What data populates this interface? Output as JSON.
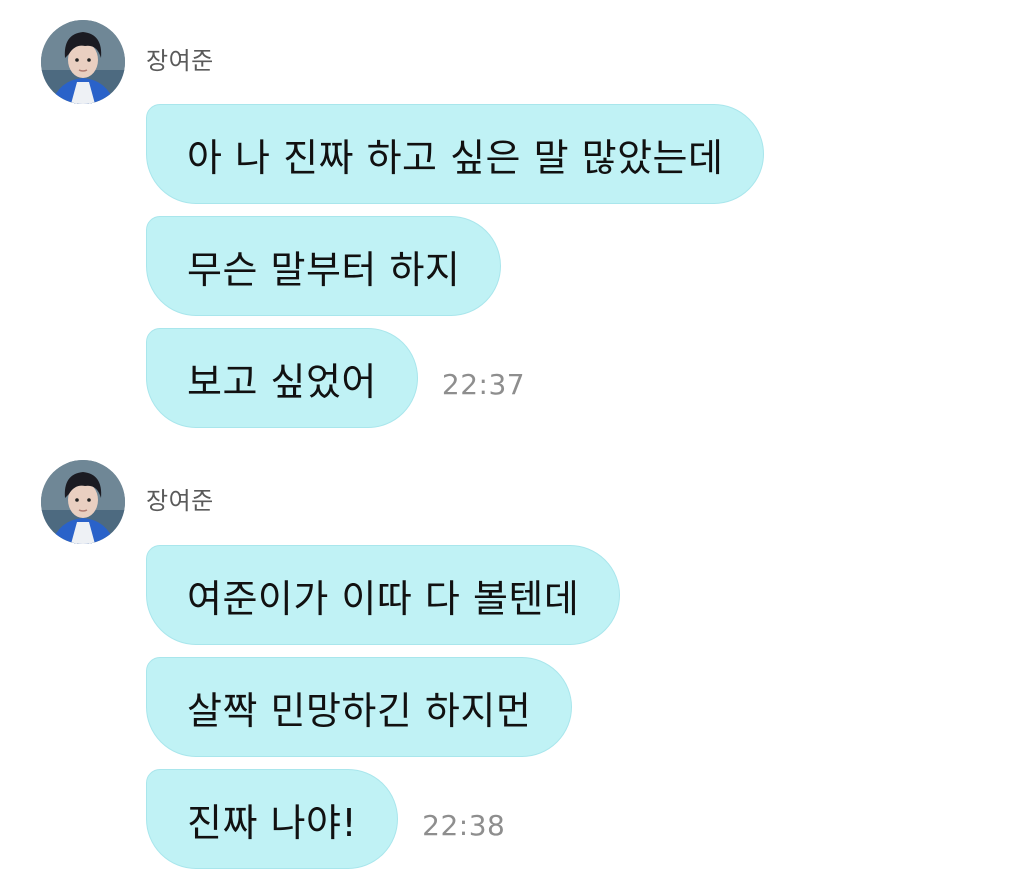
{
  "chat": {
    "groups": [
      {
        "sender": "장여준",
        "messages": [
          "아 나 진짜 하고 싶은 말 많았는데",
          "무슨 말부터 하지",
          "보고 싶었어"
        ],
        "time": "22:37"
      },
      {
        "sender": "장여준",
        "messages": [
          "여준이가 이따 다 볼텐데",
          "살짝 민망하긴 하지먼",
          "진짜 나야!"
        ],
        "time": "22:38"
      }
    ]
  },
  "colors": {
    "bubble": "#c0f2f5",
    "bubble_border": "#a9e6ec",
    "sender_text": "#5a5a5a",
    "time_text": "#8e8e8e"
  }
}
